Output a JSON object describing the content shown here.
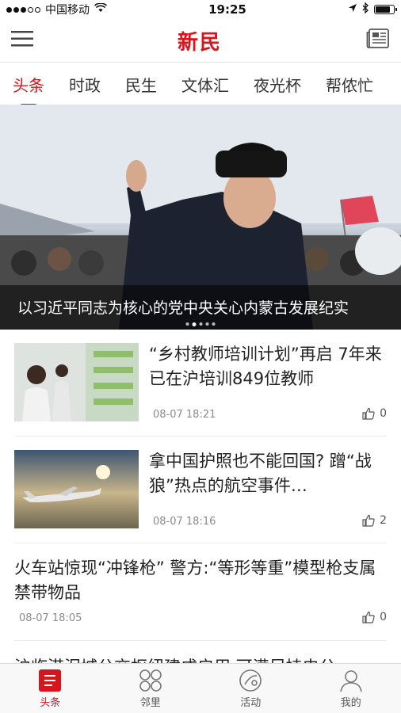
{
  "status": {
    "carrier": "中国移动",
    "time": "19:25"
  },
  "brand": "新民",
  "tabs": [
    "头条",
    "时政",
    "民生",
    "文体汇",
    "夜光杯",
    "帮侬忙"
  ],
  "hero": {
    "caption": "以习近平同志为核心的党中央关心内蒙古发展纪实",
    "slide_count": 5,
    "active_slide": 2
  },
  "news": [
    {
      "title": "“乡村教师培训计划”再启 7年来已在沪培训849位教师",
      "time": "08-07 18:21",
      "likes": "0"
    },
    {
      "title": "拿中国护照也不能回国? 蹭“战狼”热点的航空事件…",
      "time": "08-07 18:16",
      "likes": "2"
    },
    {
      "title": "火车站惊现“冲锋枪” 警方:“等形等重”模型枪支属禁带物品",
      "time": "08-07 18:05",
      "likes": "0"
    }
  ],
  "partial_headline": "沪临港泥城公交枢纽建成启用 可满足持电公",
  "tabbar": [
    "头条",
    "邻里",
    "活动",
    "我的"
  ],
  "colors": {
    "accent": "#d8141c"
  },
  "icons": {
    "menu": "hamburger-icon",
    "newspaper": "newspaper-icon",
    "like": "thumbs-up-icon"
  }
}
